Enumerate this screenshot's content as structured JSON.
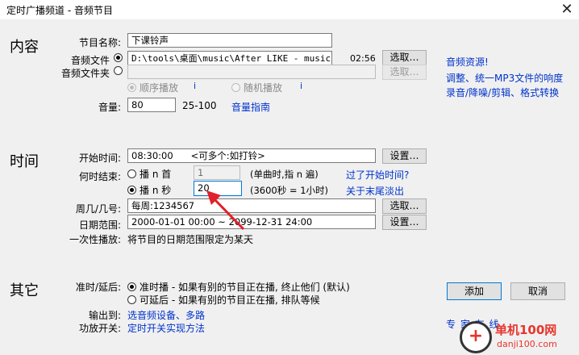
{
  "window": {
    "title": "定时广播频道 - 音频节目",
    "close": "✕"
  },
  "content": {
    "section": "内容",
    "program_name_label": "节目名称:",
    "program_name_value": "下课铃声",
    "audio_file_label": "音频文件",
    "audio_file_path": "D:\\tools\\桌面\\music\\After LIKE - music - I",
    "duration": "02:56",
    "audio_folder_label": "音频文件夹",
    "audio_folder_value": "",
    "choose_label": "选取…",
    "sequential_label": "顺序播放",
    "random_label": "随机播放",
    "info_glyph": "i",
    "volume_label": "音量:",
    "volume_value": "80",
    "volume_range": "25-100",
    "volume_guide": "音量指南"
  },
  "sidebar_links": {
    "audio_resources": "音频资源!",
    "adjust_mp3": "调整、统一MP3文件的响度",
    "record_edit": "录音/降噪/剪辑、格式转换"
  },
  "time": {
    "section": "时间",
    "start_label": "开始时间:",
    "start_value": "08:30:00      <可多个:如打铃>",
    "settings_label": "设置…",
    "end_when_label": "何时结束:",
    "play_n_tracks_label": "播 n 首",
    "n_tracks_value": "1",
    "n_tracks_hint": "(单曲时,指 n 遍)",
    "past_start_link": "过了开始时间?",
    "play_n_seconds_label": "播 n 秒",
    "n_seconds_value": "20",
    "n_seconds_hint": "(3600秒 = 1小时)",
    "fade_link": "关于末尾淡出",
    "weekday_label": "周几/几号:",
    "weekday_value": "每周:1234567",
    "choose_label": "选取…",
    "date_range_label": "日期范围:",
    "date_range_value": "2000-01-01 00:00 ~ 2099-12-31 24:00",
    "once_label": "一次性播放:",
    "once_text": "将节目的日期范围限定为某天"
  },
  "other": {
    "section": "其它",
    "timing_label": "准时/延后:",
    "ontime_text": "准时播 - 如果有别的节目正在播, 终止他们 (默认)",
    "delay_text": "可延后 - 如果有别的节目正在播, 排队等候",
    "output_label": "输出到:",
    "output_link": "选音频设备、多路",
    "power_label": "功放开关:",
    "power_link": "定时开关实现方法"
  },
  "actions": {
    "add_label": "添加",
    "cancel_label": "取消",
    "expert_online": "专 家 在 线"
  },
  "watermark": {
    "text": "单机100网",
    "url": "danji100.com",
    "plus": "+"
  },
  "colors": {
    "link": "#0033cc",
    "arrow": "#e0202a",
    "watermark": "#e8352c"
  }
}
